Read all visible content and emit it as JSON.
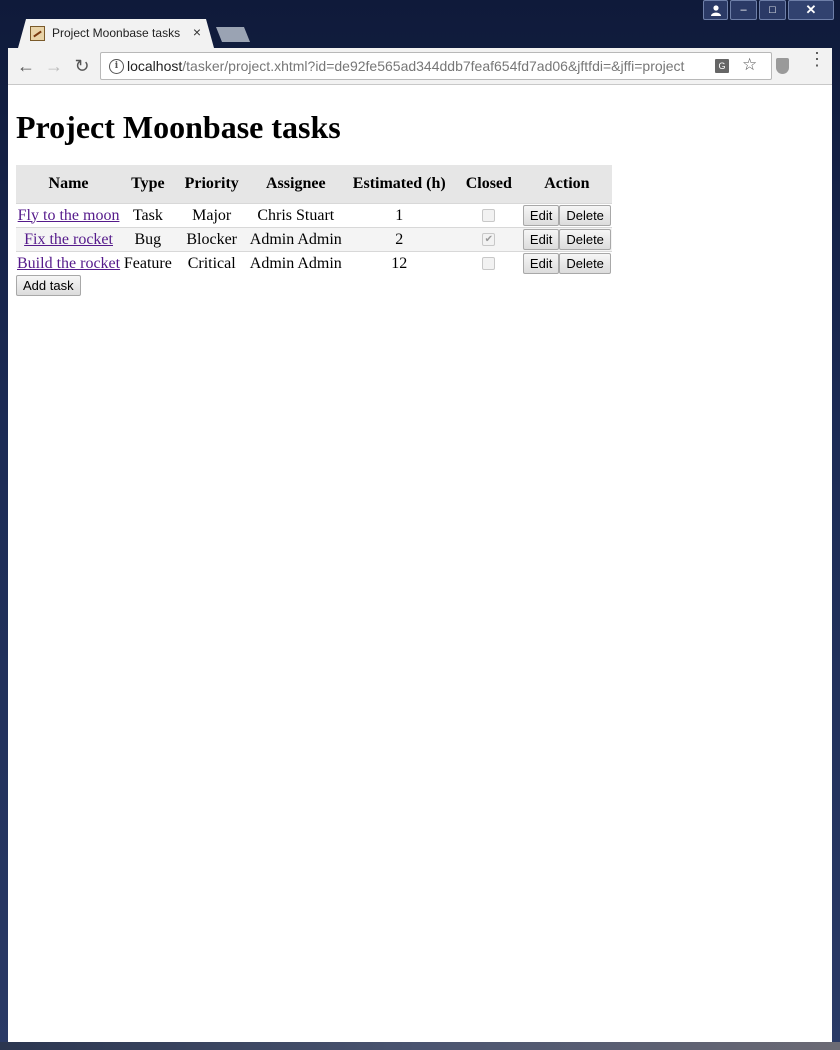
{
  "browser": {
    "tab_title": "Project Moonbase tasks",
    "tab_close": "×",
    "window_buttons": {
      "minimize": "–",
      "maximize": "□",
      "close": "✕"
    },
    "nav": {
      "back": "←",
      "forward": "→",
      "reload": "↻"
    },
    "url_host": "localhost",
    "url_rest": "/tasker/project.xhtml?id=de92fe565ad344ddb7feaf654fd7ad06&jftfdi=&jffi=project",
    "info": "i",
    "translate": "G",
    "star": "☆",
    "menu": "⋮"
  },
  "page": {
    "heading": "Project Moonbase tasks",
    "columns": [
      "Name",
      "Type",
      "Priority",
      "Assignee",
      "Estimated (h)",
      "Closed",
      "Action"
    ],
    "rows": [
      {
        "name": "Fly to the moon",
        "type": "Task",
        "priority": "Major",
        "assignee": "Chris Stuart",
        "estimate": "1",
        "closed": false,
        "edit": "Edit",
        "delete": "Delete"
      },
      {
        "name": "Fix the rocket",
        "type": "Bug",
        "priority": "Blocker",
        "assignee": "Admin Admin",
        "estimate": "2",
        "closed": true,
        "edit": "Edit",
        "delete": "Delete"
      },
      {
        "name": "Build the rocket",
        "type": "Feature",
        "priority": "Critical",
        "assignee": "Admin Admin",
        "estimate": "12",
        "closed": false,
        "edit": "Edit",
        "delete": "Delete"
      }
    ],
    "add_task": "Add task"
  }
}
